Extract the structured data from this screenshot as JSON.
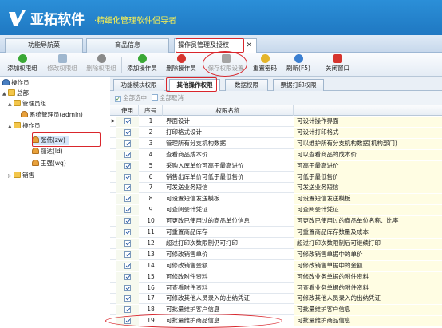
{
  "header": {
    "brand": "亚拓软件",
    "slogan": "·精细化管理软件倡导者"
  },
  "main_tabs": [
    {
      "label": "功能导航菜"
    },
    {
      "label": "商品信息"
    },
    {
      "label": "操作员管理及授权",
      "active": true
    }
  ],
  "toolbar": {
    "items": [
      {
        "label": "添加权限组",
        "icon": "add-icon",
        "color": "#3aa835",
        "enabled": true
      },
      {
        "label": "修改权限组",
        "icon": "edit-icon",
        "color": "#9fb7cf",
        "enabled": false
      },
      {
        "label": "删除权限组",
        "icon": "delete-icon",
        "color": "#8a8a8a",
        "enabled": false
      },
      {
        "label": "添加操作员",
        "icon": "add-user-icon",
        "color": "#3aa835",
        "enabled": true
      },
      {
        "label": "删除操作员",
        "icon": "delete-user-icon",
        "color": "#d6342e",
        "enabled": true
      },
      {
        "label": "保存权限设置",
        "icon": "save-icon",
        "color": "#a4a4a4",
        "enabled": false
      },
      {
        "label": "重置密码",
        "icon": "key-icon",
        "color": "#e5b52a",
        "enabled": true
      },
      {
        "label": "刷新(F5)",
        "icon": "refresh-icon",
        "color": "#3b7fd1",
        "enabled": true
      },
      {
        "label": "关闭窗口",
        "icon": "close-window-icon",
        "color": "#d6342e",
        "enabled": true
      }
    ]
  },
  "tree": {
    "root": "操作员",
    "items": [
      {
        "label": "总部",
        "level": 0,
        "type": "folder",
        "expander": "▲"
      },
      {
        "label": "管理员组",
        "level": 1,
        "type": "group",
        "expander": "▲"
      },
      {
        "label": "系统管理员(admin)",
        "level": 2,
        "type": "user",
        "expander": ""
      },
      {
        "label": "操作员",
        "level": 1,
        "type": "group",
        "expander": "▲"
      },
      {
        "label": "张伟(zw)",
        "level": 2,
        "type": "user",
        "expander": "",
        "selected": true
      },
      {
        "label": "丽达(ld)",
        "level": 2,
        "type": "user",
        "expander": ""
      },
      {
        "label": "王强(wq)",
        "level": 2,
        "type": "user",
        "expander": ""
      },
      {
        "label": "销售",
        "level": 1,
        "type": "group",
        "expander": "▷"
      }
    ]
  },
  "sub_tabs": [
    {
      "label": "功能模块权限"
    },
    {
      "label": "其他操作权限",
      "active": true
    },
    {
      "label": "数据权限"
    },
    {
      "label": "票据打印权限"
    }
  ],
  "select_bar": {
    "select_all": "全部选中",
    "deselect_all": "全部取消"
  },
  "grid": {
    "headers": {
      "use": "使用",
      "seq": "序号",
      "name": "权限名称",
      "desc": ""
    },
    "rows": [
      {
        "seq": "1",
        "name": "界面设计",
        "desc": "可设计操作界面",
        "current": true
      },
      {
        "seq": "2",
        "name": "打印格式设计",
        "desc": "可设计打印格式"
      },
      {
        "seq": "3",
        "name": "管理所有分支机构数据",
        "desc": "可以维护所有分支机构数据(机构部门)"
      },
      {
        "seq": "4",
        "name": "查看商品成本价",
        "desc": "可以查看商品的成本价"
      },
      {
        "seq": "5",
        "name": "采购入库单价可高于最高进价",
        "desc": "可高于最高进价"
      },
      {
        "seq": "6",
        "name": "销售出库单价可低于最低售价",
        "desc": "可低于最低售价"
      },
      {
        "seq": "7",
        "name": "可发送业务短信",
        "desc": "可发送业务短信"
      },
      {
        "seq": "8",
        "name": "可设置短信发送模板",
        "desc": "可设置短信发送模板"
      },
      {
        "seq": "9",
        "name": "可查阅会计凭证",
        "desc": "可查阅会计凭证"
      },
      {
        "seq": "10",
        "name": "可更改已使用过的商品单位信息",
        "desc": "可更改已使用过的商品单位名称、比率"
      },
      {
        "seq": "11",
        "name": "可重置商品库存",
        "desc": "可重置商品库存数量及成本"
      },
      {
        "seq": "12",
        "name": "超过打印次数限制仍可打印",
        "desc": "超过打印次数限制后可继续打印"
      },
      {
        "seq": "13",
        "name": "可修改销售单价",
        "desc": "可修改销售单据中的单价"
      },
      {
        "seq": "14",
        "name": "可修改销售金额",
        "desc": "可修改销售单据中的金额"
      },
      {
        "seq": "15",
        "name": "可修改附件资料",
        "desc": "可修改业务单据的附件资料"
      },
      {
        "seq": "16",
        "name": "可查看附件资料",
        "desc": "可查看业务单据的附件资料"
      },
      {
        "seq": "17",
        "name": "可修改其他人员录入的出纳凭证",
        "desc": "可修改其他人员录入的出纳凭证"
      },
      {
        "seq": "18",
        "name": "可批量维护客户信息",
        "desc": "可批量维护客户信息"
      },
      {
        "seq": "19",
        "name": "可批量维护商品信息",
        "desc": "可批量维护商品信息"
      }
    ]
  },
  "colors": {
    "header_blue": "#1f78c2",
    "highlight_red": "#d9262c",
    "slogan_yellow": "#fff34f"
  }
}
